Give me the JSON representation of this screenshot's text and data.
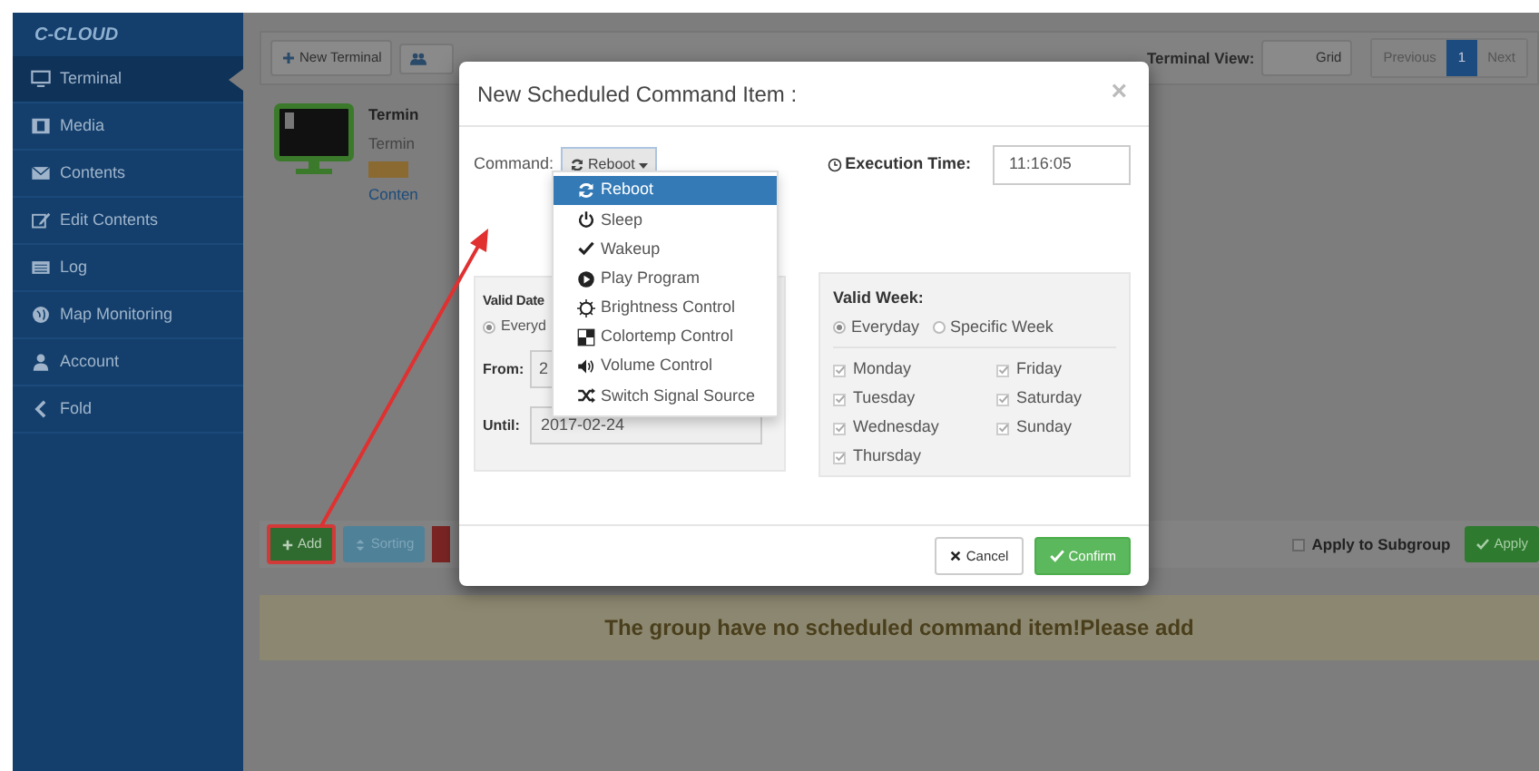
{
  "sidebar": {
    "logo": "C-CLOUD",
    "items": [
      {
        "label": "Terminal",
        "selected": true
      },
      {
        "label": "Media",
        "selected": false
      },
      {
        "label": "Contents",
        "selected": false
      },
      {
        "label": "Edit Contents",
        "selected": false
      },
      {
        "label": "Log",
        "selected": false
      },
      {
        "label": "Map Monitoring",
        "selected": false
      },
      {
        "label": "Account",
        "selected": false
      },
      {
        "label": "Fold",
        "selected": false
      }
    ]
  },
  "toolbar": {
    "new_terminal": "New Terminal",
    "view_label": "Terminal View:",
    "view_value": "Grid",
    "pagination": [
      {
        "label": "Previous",
        "selected": false
      },
      {
        "label": "1",
        "selected": true
      },
      {
        "label": "Next",
        "selected": false
      }
    ]
  },
  "terminal_card": {
    "name": "Termin",
    "line_2": "Termin",
    "link": "Conten"
  },
  "schedule_toolbar": {
    "add": "Add",
    "sorting": "Sorting",
    "apply_to_subgroup": {
      "label": "Apply to Subgroup",
      "checked": false
    },
    "apply": "Apply"
  },
  "empty_message": "The group have no scheduled command item!Please add",
  "dialog": {
    "title": "New Scheduled Command Item :",
    "close": "×",
    "command_label": "Command:",
    "command_value": "Reboot",
    "command_options": [
      {
        "label": "Reboot",
        "selected": true
      },
      {
        "label": "Sleep",
        "selected": false
      },
      {
        "label": "Wakeup",
        "selected": false
      },
      {
        "label": "Play Program",
        "selected": false
      },
      {
        "label": "Brightness Control",
        "selected": false
      },
      {
        "label": "Colortemp Control",
        "selected": false
      },
      {
        "label": "Volume Control",
        "selected": false
      },
      {
        "label": "Switch Signal Source",
        "selected": false
      }
    ],
    "execution_time_label": "Execution Time:",
    "execution_time": "11:16:05",
    "valid_date": {
      "title": "Valid Date",
      "modes": [
        {
          "label": "Everyd",
          "selected": true
        }
      ],
      "from_label": "From:",
      "from_value": "2",
      "until_label": "Until:",
      "until_value": "2017-02-24"
    },
    "valid_week": {
      "title": "Valid Week:",
      "modes": [
        {
          "label": "Everyday",
          "selected": true
        },
        {
          "label": "Specific Week",
          "selected": false
        }
      ],
      "days": [
        {
          "label": "Monday",
          "checked": true
        },
        {
          "label": "Tuesday",
          "checked": true
        },
        {
          "label": "Wednesday",
          "checked": true
        },
        {
          "label": "Thursday",
          "checked": true
        },
        {
          "label": "Friday",
          "checked": true
        },
        {
          "label": "Saturday",
          "checked": true
        },
        {
          "label": "Sunday",
          "checked": true
        }
      ]
    },
    "cancel": "Cancel",
    "confirm": "Confirm"
  }
}
